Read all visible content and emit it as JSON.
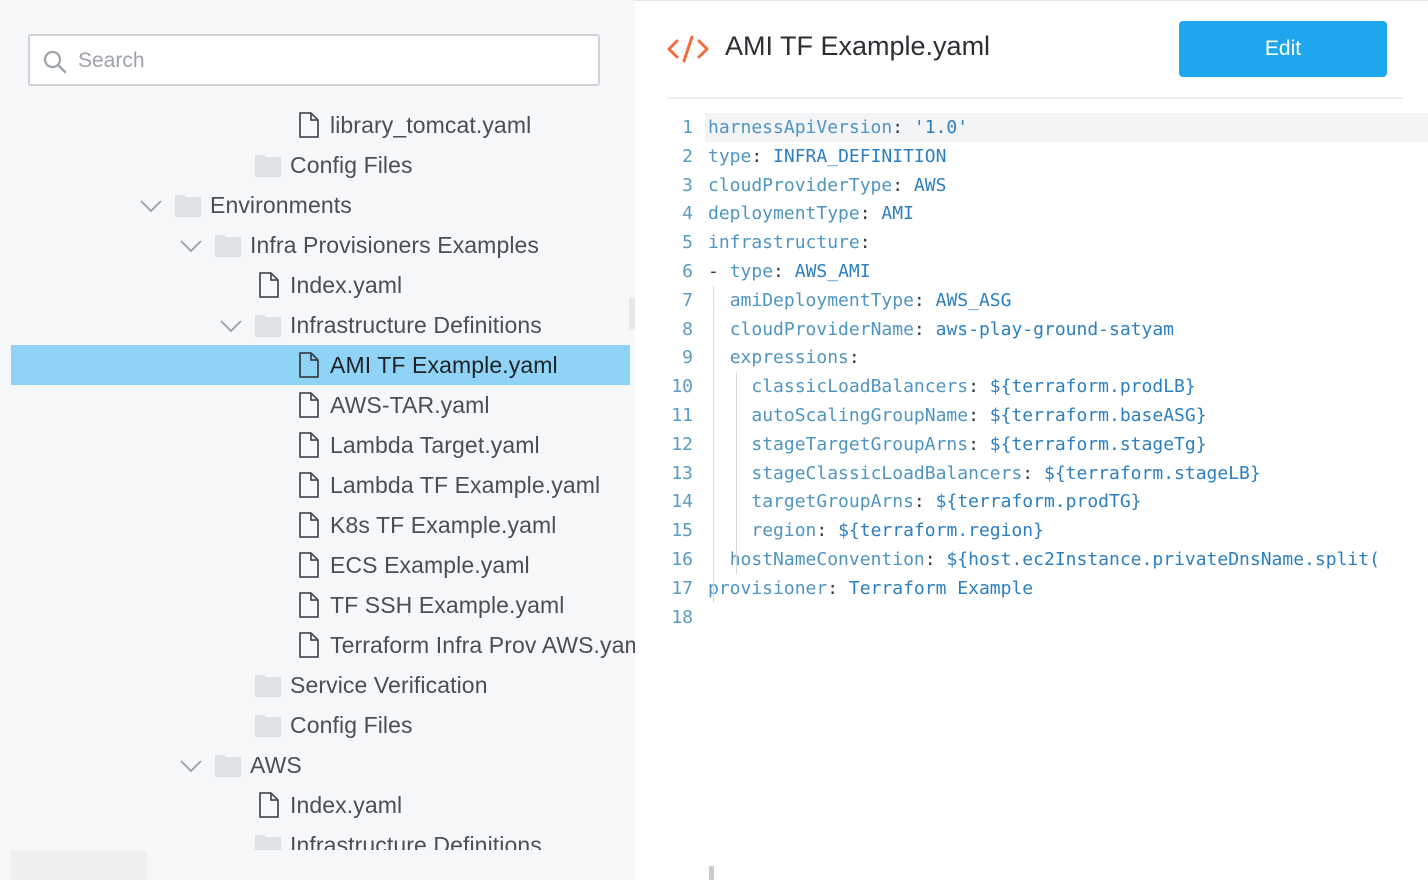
{
  "search": {
    "placeholder": "Search"
  },
  "tree": [
    {
      "label": "library_tomcat.yaml",
      "type": "file",
      "depth": 4,
      "expanded": false,
      "selected": false
    },
    {
      "label": "Config Files",
      "type": "folder",
      "depth": 3,
      "expanded": false,
      "selected": false
    },
    {
      "label": "Environments",
      "type": "folder",
      "depth": 1,
      "expanded": true,
      "selected": false
    },
    {
      "label": "Infra Provisioners Examples",
      "type": "folder",
      "depth": 2,
      "expanded": true,
      "selected": false
    },
    {
      "label": "Index.yaml",
      "type": "file",
      "depth": 3,
      "expanded": false,
      "selected": false
    },
    {
      "label": "Infrastructure Definitions",
      "type": "folder",
      "depth": 3,
      "expanded": true,
      "selected": false
    },
    {
      "label": "AMI TF Example.yaml",
      "type": "file",
      "depth": 4,
      "expanded": false,
      "selected": true
    },
    {
      "label": "AWS-TAR.yaml",
      "type": "file",
      "depth": 4,
      "expanded": false,
      "selected": false
    },
    {
      "label": "Lambda Target.yaml",
      "type": "file",
      "depth": 4,
      "expanded": false,
      "selected": false
    },
    {
      "label": "Lambda TF Example.yaml",
      "type": "file",
      "depth": 4,
      "expanded": false,
      "selected": false
    },
    {
      "label": "K8s TF Example.yaml",
      "type": "file",
      "depth": 4,
      "expanded": false,
      "selected": false
    },
    {
      "label": "ECS Example.yaml",
      "type": "file",
      "depth": 4,
      "expanded": false,
      "selected": false
    },
    {
      "label": "TF SSH Example.yaml",
      "type": "file",
      "depth": 4,
      "expanded": false,
      "selected": false
    },
    {
      "label": "Terraform Infra Prov AWS.yaml",
      "type": "file",
      "depth": 4,
      "expanded": false,
      "selected": false
    },
    {
      "label": "Service Verification",
      "type": "folder",
      "depth": 3,
      "expanded": false,
      "selected": false
    },
    {
      "label": "Config Files",
      "type": "folder",
      "depth": 3,
      "expanded": false,
      "selected": false
    },
    {
      "label": "AWS",
      "type": "folder",
      "depth": 2,
      "expanded": true,
      "selected": false
    },
    {
      "label": "Index.yaml",
      "type": "file",
      "depth": 3,
      "expanded": false,
      "selected": false
    },
    {
      "label": "Infrastructure Definitions",
      "type": "folder",
      "depth": 3,
      "expanded": false,
      "selected": false
    }
  ],
  "editor": {
    "title": "AMI TF Example.yaml",
    "edit_label": "Edit",
    "lines": [
      {
        "n": "1",
        "indent": 0,
        "dash": false,
        "key": "harnessApiVersion",
        "value": "'1.0'"
      },
      {
        "n": "2",
        "indent": 0,
        "dash": false,
        "key": "type",
        "value": "INFRA_DEFINITION"
      },
      {
        "n": "3",
        "indent": 0,
        "dash": false,
        "key": "cloudProviderType",
        "value": "AWS"
      },
      {
        "n": "4",
        "indent": 0,
        "dash": false,
        "key": "deploymentType",
        "value": "AMI"
      },
      {
        "n": "5",
        "indent": 0,
        "dash": false,
        "key": "infrastructure",
        "value": ""
      },
      {
        "n": "6",
        "indent": 0,
        "dash": true,
        "key": "type",
        "value": "AWS_AMI"
      },
      {
        "n": "7",
        "indent": 1,
        "dash": false,
        "key": "amiDeploymentType",
        "value": "AWS_ASG"
      },
      {
        "n": "8",
        "indent": 1,
        "dash": false,
        "key": "cloudProviderName",
        "value": "aws-play-ground-satyam"
      },
      {
        "n": "9",
        "indent": 1,
        "dash": false,
        "key": "expressions",
        "value": ""
      },
      {
        "n": "10",
        "indent": 2,
        "dash": false,
        "key": "classicLoadBalancers",
        "value": "${terraform.prodLB}"
      },
      {
        "n": "11",
        "indent": 2,
        "dash": false,
        "key": "autoScalingGroupName",
        "value": "${terraform.baseASG}"
      },
      {
        "n": "12",
        "indent": 2,
        "dash": false,
        "key": "stageTargetGroupArns",
        "value": "${terraform.stageTg}"
      },
      {
        "n": "13",
        "indent": 2,
        "dash": false,
        "key": "stageClassicLoadBalancers",
        "value": "${terraform.stageLB}"
      },
      {
        "n": "14",
        "indent": 2,
        "dash": false,
        "key": "targetGroupArns",
        "value": "${terraform.prodTG}"
      },
      {
        "n": "15",
        "indent": 2,
        "dash": false,
        "key": "region",
        "value": "${terraform.region}"
      },
      {
        "n": "16",
        "indent": 1,
        "dash": false,
        "key": "hostNameConvention",
        "value": "${host.ec2Instance.privateDnsName.split("
      },
      {
        "n": "17",
        "indent": 0,
        "dash": false,
        "key": "provisioner",
        "value": "Terraform Example"
      },
      {
        "n": "18",
        "indent": 0,
        "dash": false,
        "key": "",
        "value": ""
      }
    ]
  },
  "colors": {
    "selection": "#8fd4f7",
    "accent": "#1ea7ee",
    "code_icon": "#f26b3a"
  }
}
